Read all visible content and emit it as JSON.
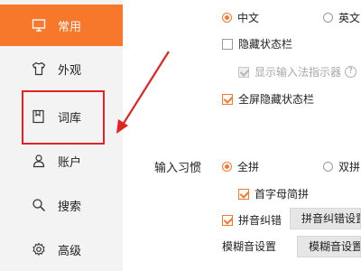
{
  "sidebar": {
    "items": [
      {
        "label": "常用",
        "icon": "monitor-icon"
      },
      {
        "label": "外观",
        "icon": "shirt-icon"
      },
      {
        "label": "词库",
        "icon": "book-icon"
      },
      {
        "label": "账户",
        "icon": "user-icon"
      },
      {
        "label": "搜索",
        "icon": "search-icon"
      },
      {
        "label": "高级",
        "icon": "gear-icon"
      }
    ]
  },
  "language": {
    "options": [
      "中文",
      "英文"
    ],
    "selected": "中文"
  },
  "status_bar": {
    "hide_label": "隐藏状态栏",
    "show_indicator_label": "显示输入法指示器",
    "help": "?",
    "fullscreen_hide_label": "全屏隐藏状态栏"
  },
  "input_habit": {
    "label": "输入习惯",
    "options": [
      "全拼",
      "双拼"
    ],
    "selected": "全拼",
    "initial_abbr_label": "首字母简拼",
    "pinyin_correction_label": "拼音纠错",
    "pinyin_correction_settings_button": "拼音纠错设置",
    "fuzzy_label": "模糊音设置",
    "fuzzy_settings_button": "模糊音设置"
  },
  "colors": {
    "accent": "#f7772b",
    "highlight": "#e02424",
    "sidebar_bg": "#f3f3f3"
  }
}
